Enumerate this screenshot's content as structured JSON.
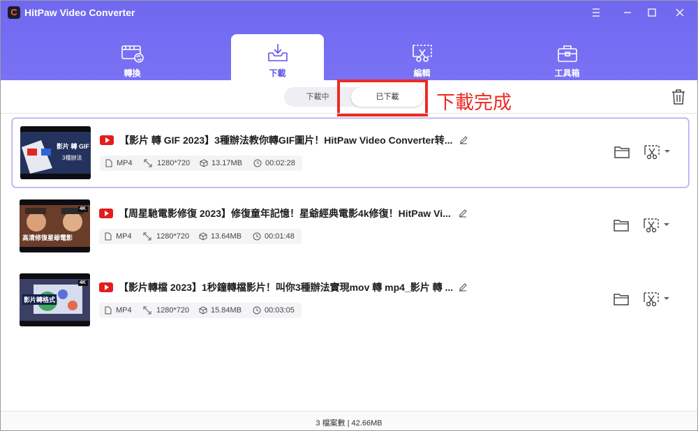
{
  "app": {
    "title": "HitPaw Video Converter",
    "logo_letter": "C"
  },
  "nav": {
    "tabs": [
      {
        "label": "轉換",
        "icon": "film-convert-icon"
      },
      {
        "label": "下載",
        "icon": "download-tray-icon",
        "active": true
      },
      {
        "label": "編輯",
        "icon": "scissors-edit-icon"
      },
      {
        "label": "工具箱",
        "icon": "toolbox-icon"
      }
    ]
  },
  "toolbar": {
    "segment_downloading": "下載中",
    "segment_downloaded": "已下載",
    "annotation": "下載完成"
  },
  "colors": {
    "accent": "#6f68f0",
    "highlight": "#ee2a24"
  },
  "items": [
    {
      "title": "【影片 轉 GIF 2023】3種辦法教你轉GIF圖片！HitPaw Video Converter转...",
      "format": "MP4",
      "resolution": "1280*720",
      "size": "13.17MB",
      "duration": "00:02:28",
      "thumb_text": "影片 轉 GIF",
      "thumb_sub": "3種辦法"
    },
    {
      "title": "【周星馳電影修復 2023】修復童年記憶！星爺經典電影4k修復！HitPaw Vi...",
      "format": "MP4",
      "resolution": "1280*720",
      "size": "13.64MB",
      "duration": "00:01:48",
      "thumb_text": "高清修復星爺電影",
      "thumb_badge": "4K"
    },
    {
      "title": "【影片轉檔 2023】1秒鐘轉檔影片！叫你3種辦法實現mov 轉 mp4_影片 轉 ...",
      "format": "MP4",
      "resolution": "1280*720",
      "size": "15.84MB",
      "duration": "00:03:05",
      "thumb_text": "影片轉格式",
      "thumb_badge": "4K"
    }
  ],
  "footer": {
    "summary": "3 檔案數 | 42.66MB"
  }
}
